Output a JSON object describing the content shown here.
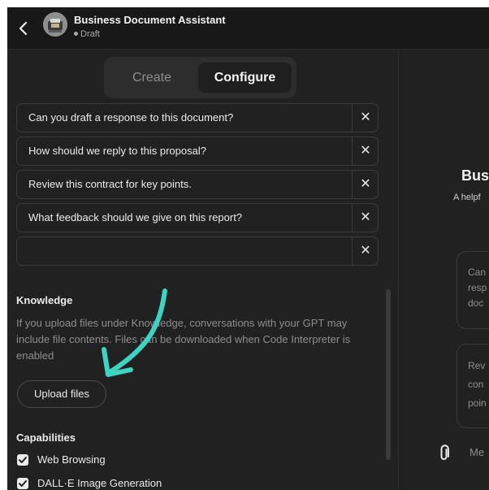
{
  "header": {
    "title": "Business Document Assistant",
    "status": "Draft"
  },
  "tabs": {
    "create": "Create",
    "configure": "Configure",
    "active": "Configure"
  },
  "conversation_starters": [
    "Can you draft a response to this document?",
    "How should we reply to this proposal?",
    "Review this contract for key points.",
    "What feedback should we give on this report?",
    ""
  ],
  "knowledge": {
    "heading": "Knowledge",
    "description": "If you upload files under Knowledge, conversations with your GPT may include file contents. Files can be downloaded when Code Interpreter is enabled",
    "upload_label": "Upload files"
  },
  "capabilities": {
    "heading": "Capabilities",
    "items": [
      {
        "label": "Web Browsing",
        "checked": true
      },
      {
        "label": "DALL·E Image Generation",
        "checked": true
      }
    ]
  },
  "preview": {
    "title": "Bus",
    "description": "A helpf",
    "card1": [
      "Can",
      "resp",
      "doc"
    ],
    "card2": [
      "Rev",
      "con",
      "poin"
    ],
    "message_placeholder": "Me"
  },
  "colors": {
    "panel": "#212121",
    "header": "#181818",
    "annotation_arrow": "#3fd3c2"
  },
  "icons": [
    "chevron-left-icon",
    "gpt-avatar-icon",
    "close-icon",
    "checkbox-checked-icon",
    "paperclip-icon",
    "annotation-arrow"
  ]
}
